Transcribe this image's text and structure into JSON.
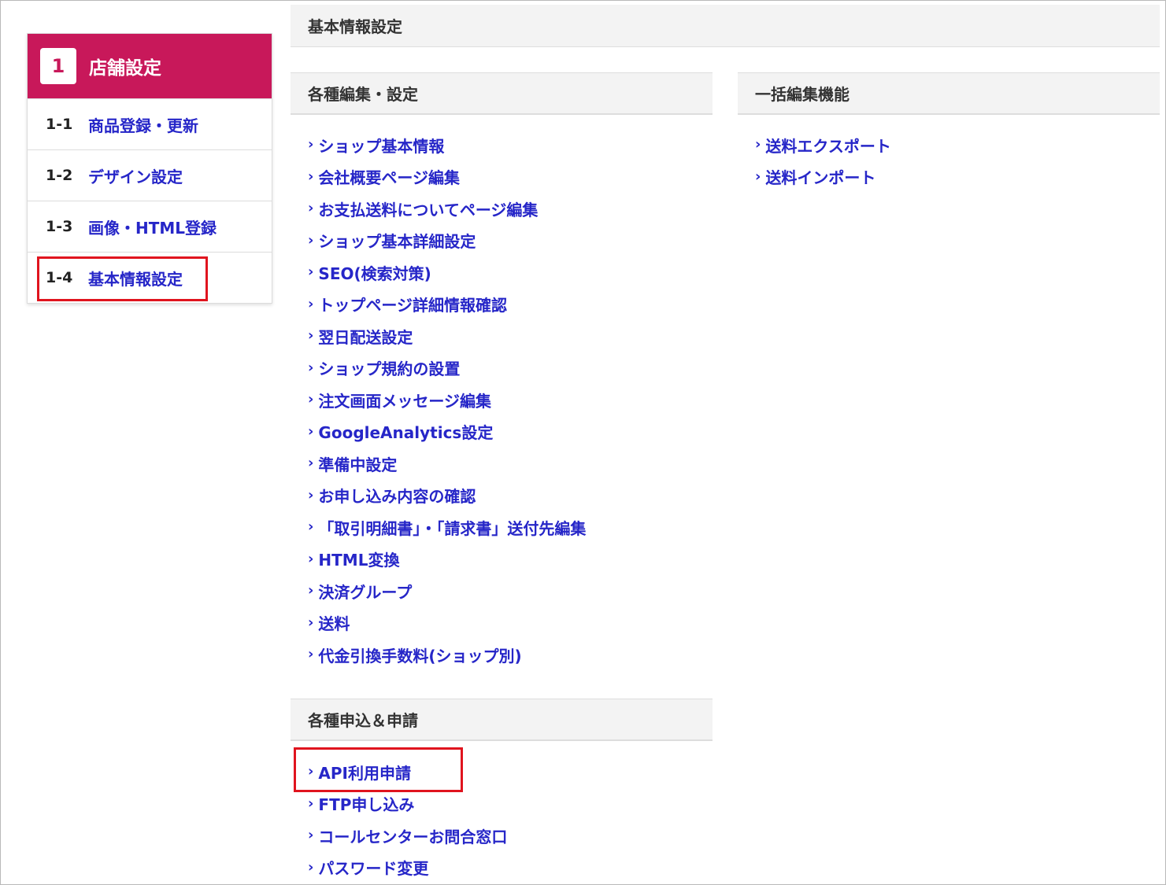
{
  "sidebar": {
    "head_number": "1",
    "head_title": "店舗設定",
    "items": [
      {
        "num": "1-1",
        "label": "商品登録・更新"
      },
      {
        "num": "1-2",
        "label": "デザイン設定"
      },
      {
        "num": "1-3",
        "label": "画像・HTML登録"
      },
      {
        "num": "1-4",
        "label": "基本情報設定"
      }
    ]
  },
  "main": {
    "page_title": "基本情報設定",
    "sections": {
      "edit_settings": {
        "title": "各種編集・設定",
        "links": [
          "ショップ基本情報",
          "会社概要ページ編集",
          "お支払送料についてページ編集",
          "ショップ基本詳細設定",
          "SEO(検索対策)",
          "トップページ詳細情報確認",
          "翌日配送設定",
          "ショップ規約の設置",
          "注文画面メッセージ編集",
          "GoogleAnalytics設定",
          "準備中設定",
          "お申し込み内容の確認",
          "「取引明細書」・「請求書」送付先編集",
          "HTML変換",
          "決済グループ",
          "送料",
          "代金引換手数料(ショップ別)"
        ]
      },
      "bulk_edit": {
        "title": "一括編集機能",
        "links": [
          "送料エクスポート",
          "送料インポート"
        ]
      },
      "applications": {
        "title": "各種申込＆申請",
        "links": [
          "API利用申請",
          "FTP申し込み",
          "コールセンターお問合窓口",
          "パスワード変更"
        ]
      }
    }
  },
  "icons": {
    "link_chevron": "chevron-right-icon",
    "chevron_glyph": "›"
  },
  "colors": {
    "brand": "#c8185a",
    "link": "#2626c8",
    "highlight": "#e0141e"
  }
}
